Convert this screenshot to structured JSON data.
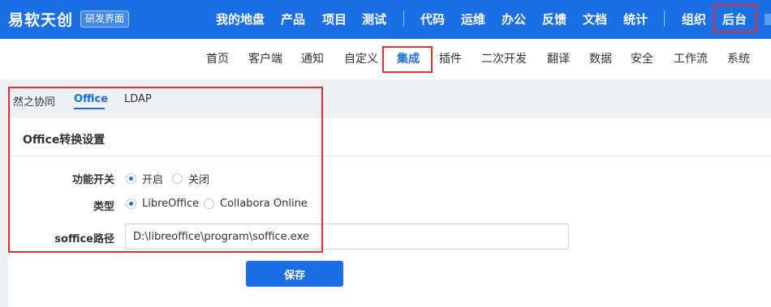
{
  "header": {
    "logo": "易软天创",
    "edition_badge": "研发界面",
    "nav": [
      "我的地盘",
      "产品",
      "项目",
      "测试",
      "代码",
      "运维",
      "办公",
      "反馈",
      "文档",
      "统计",
      "组织",
      "后台"
    ],
    "active_nav": "后台"
  },
  "admin_menu": {
    "items": [
      "首页",
      "客户端",
      "通知",
      "自定义",
      "集成",
      "插件",
      "二次开发",
      "翻译",
      "数据",
      "安全",
      "工作流",
      "系统"
    ],
    "active": "集成"
  },
  "tabs": {
    "items": [
      "然之协同",
      "Office",
      "LDAP"
    ],
    "active": "Office"
  },
  "form": {
    "title": "Office转换设置",
    "switch": {
      "label": "功能开关",
      "options": [
        "开启",
        "关闭"
      ],
      "selected": "开启"
    },
    "type": {
      "label": "类型",
      "options": [
        "LibreOffice",
        "Collabora Online"
      ],
      "selected": "LibreOffice"
    },
    "soffice_path": {
      "label": "soffice路径",
      "value": "D:\\libreoffice\\program\\soffice.exe"
    },
    "save_label": "保存"
  },
  "colors": {
    "primary": "#1a6fe6",
    "highlight": "#e03131"
  }
}
